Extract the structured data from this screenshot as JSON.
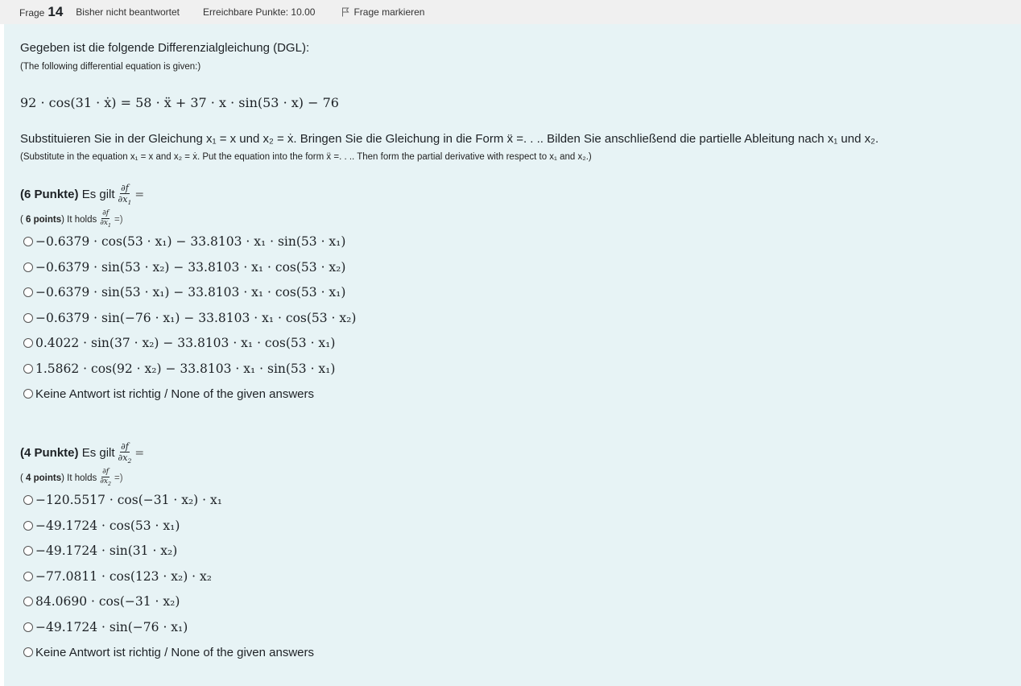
{
  "header": {
    "frage_label": "Frage",
    "question_number": "14",
    "status": "Bisher nicht beantwortet",
    "points": "Erreichbare Punkte: 10.00",
    "flag_label": "Frage markieren"
  },
  "intro": {
    "de": "Gegeben ist die folgende Differenzialgleichung (DGL):",
    "en": "(The following differential equation is given:)"
  },
  "equation": "92 · cos(31 · ẋ) = 58 · ẍ + 37 · x · sin(53 · x) − 76",
  "substitution": {
    "de": "Substituieren Sie in der Gleichung x₁ = x und x₂ = ẋ. Bringen Sie die Gleichung in die Form ẍ =. . .. Bilden Sie anschließend die partielle Ableitung nach x₁ und x₂.",
    "en": "(Substitute in the equation x₁ = x and x₂ = ẋ. Put the equation into the form ẍ =. . .. Then form the partial derivative with respect to x₁ and x₂.)"
  },
  "part1": {
    "points_de": "(6 Punkte)",
    "es_gilt": "Es gilt",
    "points_en": "6 points",
    "it_holds": "It holds",
    "options": [
      "−0.6379 · cos(53 · x₁) − 33.8103 · x₁ · sin(53 · x₁)",
      "−0.6379 · sin(53 · x₂) − 33.8103 · x₁ · cos(53 · x₂)",
      "−0.6379 · sin(53 · x₁) − 33.8103 · x₁ · cos(53 · x₁)",
      "−0.6379 · sin(−76 · x₁) − 33.8103 · x₁ · cos(53 · x₂)",
      "0.4022 · sin(37 · x₂) − 33.8103 · x₁ · cos(53 · x₁)",
      "1.5862 · cos(92 · x₂) − 33.8103 · x₁ · sin(53 · x₁)",
      "Keine Antwort ist richtig / None of the given answers"
    ]
  },
  "part2": {
    "points_de": "(4 Punkte)",
    "es_gilt": "Es gilt",
    "points_en": "4 points",
    "it_holds": "It holds",
    "options": [
      "−120.5517 · cos(−31 · x₂) · x₁",
      "−49.1724 · cos(53 · x₁)",
      "−49.1724 · sin(31 · x₂)",
      "−77.0811 · cos(123 · x₂) · x₂",
      "84.0690 · cos(−31 · x₂)",
      "−49.1724 · sin(−76 · x₁)",
      "Keine Antwort ist richtig / None of the given answers"
    ]
  }
}
